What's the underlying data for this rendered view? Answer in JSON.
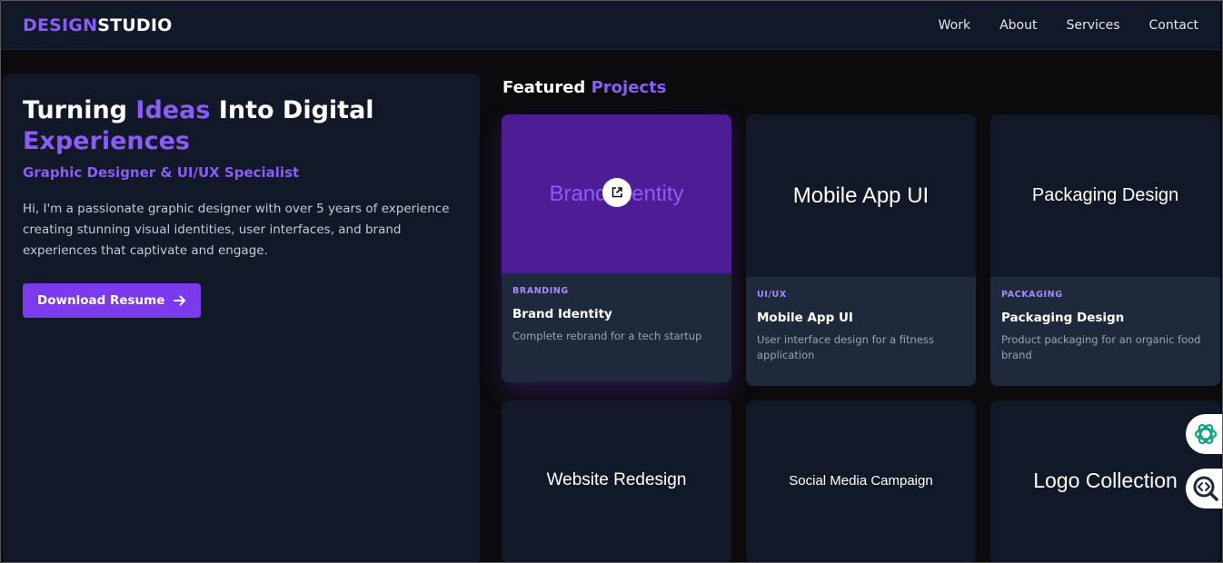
{
  "header": {
    "logo_accent": "DESIGN",
    "logo_rest": "STUDIO",
    "nav": [
      {
        "label": "Work"
      },
      {
        "label": "About"
      },
      {
        "label": "Services"
      },
      {
        "label": "Contact"
      }
    ]
  },
  "hero": {
    "title_part1": "Turning ",
    "title_highlight": "Ideas",
    "title_part2": " Into Digital",
    "title_line2": "Experiences",
    "subtitle": "Graphic Designer & UI/UX Specialist",
    "description": "Hi, I'm a passionate graphic designer with over 5 years of experience creating stunning visual identities, user interfaces, and brand experiences that captivate and engage.",
    "button_label": "Download Resume"
  },
  "projects": {
    "heading": "Featured",
    "heading_accent": "Projects",
    "cards": [
      {
        "thumb": "Brand Identity",
        "category": "BRANDING",
        "title": "Brand Identity",
        "description": "Complete rebrand for a tech startup"
      },
      {
        "thumb": "Mobile App UI",
        "category": "UI/UX",
        "title": "Mobile App UI",
        "description": "User interface design for a fitness application"
      },
      {
        "thumb": "Packaging Design",
        "category": "PACKAGING",
        "title": "Packaging Design",
        "description": "Product packaging for an organic food brand"
      },
      {
        "thumb": "Website Redesign"
      },
      {
        "thumb": "Social Media Campaign"
      },
      {
        "thumb": "Logo Collection"
      }
    ]
  },
  "colors": {
    "accent": "#8b5cf6",
    "button": "#7c3aed",
    "panel": "#111827",
    "card_info": "#1e293b",
    "background": "#0b0b0d"
  },
  "icons": [
    "external-link-icon",
    "arrow-right-icon",
    "chatgpt-icon",
    "code-search-icon"
  ]
}
